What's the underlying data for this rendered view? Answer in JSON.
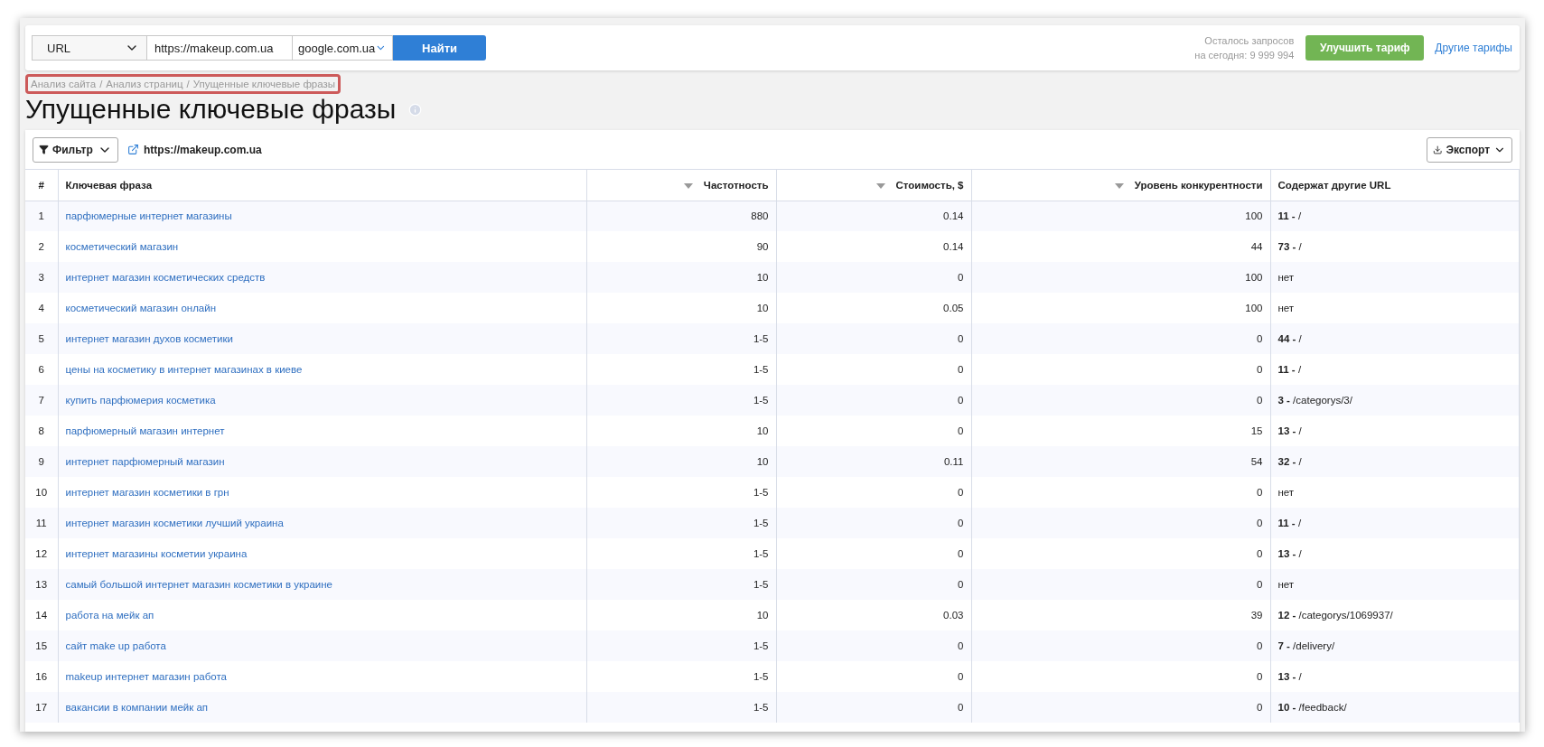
{
  "search_bar": {
    "type_select": "URL",
    "url_value": "https://makeup.com.ua",
    "engine_select": "google.com.ua",
    "submit": "Найти"
  },
  "quota": {
    "line_1": "Осталось запросов",
    "line_2": "на сегодня: 9 999 994"
  },
  "upgrade_button": "Улучшить тариф",
  "plans_link": "Другие тарифы",
  "breadcrumb": {
    "highlighted": true,
    "items": [
      "Анализ сайта",
      "Анализ страниц",
      "Упущенные ключевые фразы"
    ],
    "separator": "/"
  },
  "page_title": "Упущенные ключевые фразы",
  "toolbar": {
    "filter": "Фильтр",
    "site_link": "https://makeup.com.ua",
    "export": "Экспорт"
  },
  "table": {
    "columns": [
      {
        "label": "#",
        "sortable": false
      },
      {
        "label": "Ключевая фраза",
        "sortable": false
      },
      {
        "label": "Частотность",
        "sortable": true
      },
      {
        "label": "Стоимость, $",
        "sortable": true
      },
      {
        "label": "Уровень конкурентности",
        "sortable": true
      },
      {
        "label": "Содержат другие URL",
        "sortable": false
      }
    ],
    "rows": [
      [
        "1",
        "парфюмерные интернет магазины",
        "880",
        "0.14",
        "100",
        "**11 -** /"
      ],
      [
        "2",
        "косметический магазин",
        "90",
        "0.14",
        "44",
        "**73 -** /"
      ],
      [
        "3",
        "интернет магазин косметических средств",
        "10",
        "0",
        "100",
        "нет"
      ],
      [
        "4",
        "косметический магазин онлайн",
        "10",
        "0.05",
        "100",
        "нет"
      ],
      [
        "5",
        "интернет магазин духов косметики",
        "1-5",
        "0",
        "0",
        "**44 -** /"
      ],
      [
        "6",
        "цены на косметику в интернет магазинах в киеве",
        "1-5",
        "0",
        "0",
        "**11 -** /"
      ],
      [
        "7",
        "купить парфюмерия косметика",
        "1-5",
        "0",
        "0",
        "**3 -** /categorys/3/"
      ],
      [
        "8",
        "парфюмерный магазин интернет",
        "10",
        "0",
        "15",
        "**13 -** /"
      ],
      [
        "9",
        "интернет парфюмерный магазин",
        "10",
        "0.11",
        "54",
        "**32 -** /"
      ],
      [
        "10",
        "интернет магазин косметики в грн",
        "1-5",
        "0",
        "0",
        "нет"
      ],
      [
        "11",
        "интернет магазин косметики лучший украина",
        "1-5",
        "0",
        "0",
        "**11 -** /"
      ],
      [
        "12",
        "интернет магазины косметии украина",
        "1-5",
        "0",
        "0",
        "**13 -** /"
      ],
      [
        "13",
        "самый большой интернет магазин косметики в украине",
        "1-5",
        "0",
        "0",
        "нет"
      ],
      [
        "14",
        "работа на мейк ап",
        "10",
        "0.03",
        "39",
        "**12 -** /categorys/1069937/"
      ],
      [
        "15",
        "сайт make up работа",
        "1-5",
        "0",
        "0",
        "**7 -** /delivery/"
      ],
      [
        "16",
        "makeup интернет магазин работа",
        "1-5",
        "0",
        "0",
        "**13 -** /"
      ],
      [
        "17",
        "вакансии в компании мейк ап",
        "1-5",
        "0",
        "0",
        "**10 -** /feedback/"
      ]
    ]
  }
}
